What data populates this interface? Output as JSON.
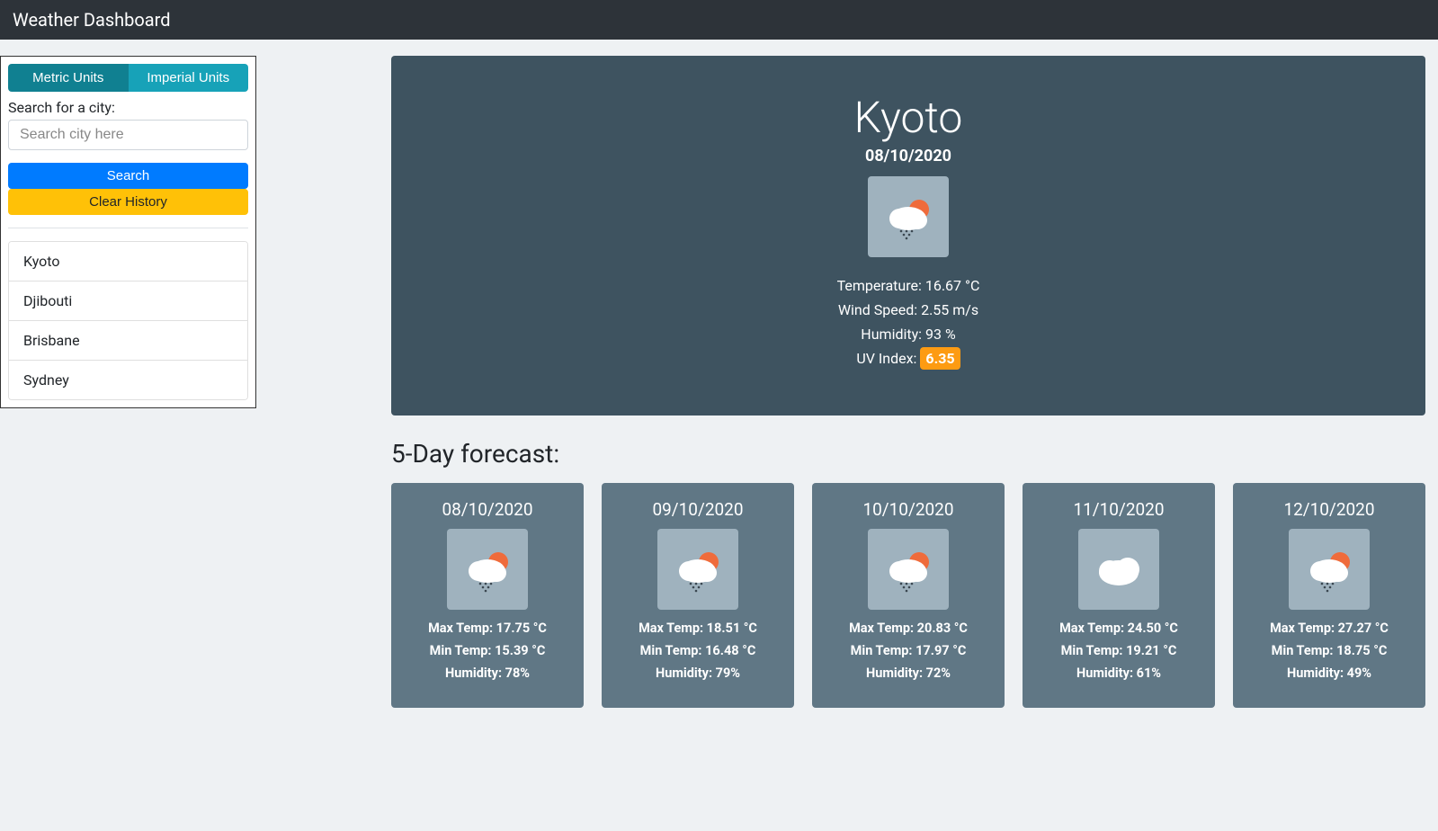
{
  "header": {
    "title": "Weather Dashboard"
  },
  "sidebar": {
    "units": {
      "metric_label": "Metric Units",
      "imperial_label": "Imperial Units",
      "active": "metric"
    },
    "search": {
      "label": "Search for a city:",
      "placeholder": "Search city here",
      "value": ""
    },
    "buttons": {
      "search": "Search",
      "clear": "Clear History"
    },
    "history": [
      "Kyoto",
      "Djibouti",
      "Brisbane",
      "Sydney"
    ]
  },
  "current": {
    "city": "Kyoto",
    "date": "08/10/2020",
    "temperature_label": "Temperature: ",
    "temperature": "16.67 °C",
    "wind_label": "Wind Speed: ",
    "wind": "2.55 m/s",
    "humidity_label": "Humidity: ",
    "humidity": "93 %",
    "uv_label": "UV Index: ",
    "uv": "6.35",
    "icon": "rain-sun"
  },
  "forecast": {
    "title": "5-Day forecast:",
    "labels": {
      "max": "Max Temp: ",
      "min": "Min Temp: ",
      "humidity": "Humidity: "
    },
    "days": [
      {
        "date": "08/10/2020",
        "icon": "rain-sun",
        "max": "17.75 °C",
        "min": "15.39 °C",
        "humidity": "78%"
      },
      {
        "date": "09/10/2020",
        "icon": "rain-sun",
        "max": "18.51 °C",
        "min": "16.48 °C",
        "humidity": "79%"
      },
      {
        "date": "10/10/2020",
        "icon": "rain-sun",
        "max": "20.83 °C",
        "min": "17.97 °C",
        "humidity": "72%"
      },
      {
        "date": "11/10/2020",
        "icon": "cloud",
        "max": "24.50 °C",
        "min": "19.21 °C",
        "humidity": "61%"
      },
      {
        "date": "12/10/2020",
        "icon": "rain-sun",
        "max": "27.27 °C",
        "min": "18.75 °C",
        "humidity": "49%"
      }
    ]
  }
}
